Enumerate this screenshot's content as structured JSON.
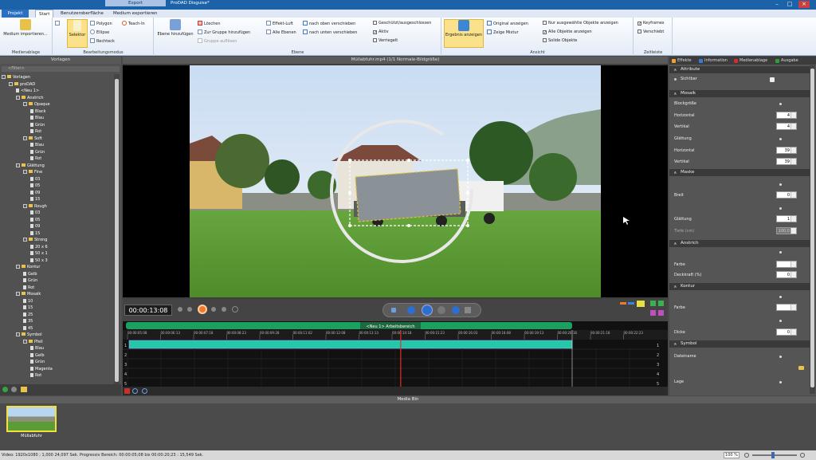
{
  "titlebar": {
    "contextual_tab": "Export",
    "title": "ProDAD Disguise*"
  },
  "tabs": [
    "Projekt",
    "Start",
    "Benutzeroberfläche",
    "Medium exportieren"
  ],
  "ribbon": {
    "groups": [
      {
        "label": "Medienablage"
      },
      {
        "label": "Bearbeitungsmodus"
      },
      {
        "label": "Ebene"
      },
      {
        "label": "Ansicht"
      },
      {
        "label": "Zeitleiste"
      }
    ],
    "import_label": "Medium importieren...",
    "selektor_label": "Selektor",
    "polygon_label": "Polygon",
    "ellipse_label": "Ellipse",
    "rechteck_label": "Rechteck",
    "teachin_label": "Teach-In",
    "ebene_add_label": "Ebene hinzufügen",
    "loeschen_label": "Löschen",
    "zur_gruppe_label": "Zur Gruppe hinzufügen",
    "aus_gruppe_label": "Gruppe auflösen",
    "effekt_luft_label": "Effekt-Luft",
    "alle_ebenen_label": "Alle Ebenen",
    "nach_oben_label": "nach oben verschieben",
    "nach_unten_label": "nach unten verschieben",
    "geschuetzt_label": "Geschützt/ausgeschlossen",
    "aktiv_label": "Aktiv",
    "verriegelt_label": "Verriegelt",
    "ergebnis_label": "Ergebnis anzeigen",
    "original_label": "Original anzeigen",
    "mixtur_label": "Zeige Mixtur",
    "nur_ausgew_label": "Nur ausgewählte Objekte anzeigen",
    "alle_objekte_label": "Alle Objekte anzeigen",
    "solide_label": "Solide Objekte",
    "keyframes_label": "Keyframes",
    "verschiebt_label": "Verschiebt"
  },
  "left_panel": {
    "title": "Vorlagen",
    "filter": "<Filter>",
    "tree": [
      {
        "label": "Vorlagen",
        "level": 0,
        "kind": "folder"
      },
      {
        "label": "proDAD",
        "level": 1,
        "kind": "folder"
      },
      {
        "label": "<Neu 1>",
        "level": 2,
        "kind": "item"
      },
      {
        "label": "Anstrich",
        "level": 2,
        "kind": "folder"
      },
      {
        "label": "Opaque",
        "level": 3,
        "kind": "folder"
      },
      {
        "label": "Black",
        "level": 4,
        "kind": "item"
      },
      {
        "label": "Blau",
        "level": 4,
        "kind": "item"
      },
      {
        "label": "Grün",
        "level": 4,
        "kind": "item"
      },
      {
        "label": "Rot",
        "level": 4,
        "kind": "item"
      },
      {
        "label": "Soft",
        "level": 3,
        "kind": "folder"
      },
      {
        "label": "Blau",
        "level": 4,
        "kind": "item"
      },
      {
        "label": "Grün",
        "level": 4,
        "kind": "item"
      },
      {
        "label": "Rot",
        "level": 4,
        "kind": "item"
      },
      {
        "label": "Glättung",
        "level": 2,
        "kind": "folder"
      },
      {
        "label": "Fine",
        "level": 3,
        "kind": "folder"
      },
      {
        "label": "03",
        "level": 4,
        "kind": "item"
      },
      {
        "label": "05",
        "level": 4,
        "kind": "item"
      },
      {
        "label": "09",
        "level": 4,
        "kind": "item"
      },
      {
        "label": "15",
        "level": 4,
        "kind": "item"
      },
      {
        "label": "Rough",
        "level": 3,
        "kind": "folder"
      },
      {
        "label": "03",
        "level": 4,
        "kind": "item"
      },
      {
        "label": "05",
        "level": 4,
        "kind": "item"
      },
      {
        "label": "09",
        "level": 4,
        "kind": "item"
      },
      {
        "label": "15",
        "level": 4,
        "kind": "item"
      },
      {
        "label": "Strong",
        "level": 3,
        "kind": "folder"
      },
      {
        "label": "20 x 6",
        "level": 4,
        "kind": "item"
      },
      {
        "label": "50 x 1",
        "level": 4,
        "kind": "item"
      },
      {
        "label": "50 x 3",
        "level": 4,
        "kind": "item"
      },
      {
        "label": "Kontur",
        "level": 2,
        "kind": "folder"
      },
      {
        "label": "Gelb",
        "level": 3,
        "kind": "item"
      },
      {
        "label": "Grün",
        "level": 3,
        "kind": "item"
      },
      {
        "label": "Rot",
        "level": 3,
        "kind": "item"
      },
      {
        "label": "Mosaik",
        "level": 2,
        "kind": "folder"
      },
      {
        "label": "10",
        "level": 3,
        "kind": "item"
      },
      {
        "label": "15",
        "level": 3,
        "kind": "item"
      },
      {
        "label": "25",
        "level": 3,
        "kind": "item"
      },
      {
        "label": "35",
        "level": 3,
        "kind": "item"
      },
      {
        "label": "45",
        "level": 3,
        "kind": "item"
      },
      {
        "label": "Symbol",
        "level": 2,
        "kind": "folder"
      },
      {
        "label": "Pfeil",
        "level": 3,
        "kind": "folder"
      },
      {
        "label": "Blau",
        "level": 4,
        "kind": "item"
      },
      {
        "label": "Gelb",
        "level": 4,
        "kind": "item"
      },
      {
        "label": "Grün",
        "level": 4,
        "kind": "item"
      },
      {
        "label": "Magenta",
        "level": 4,
        "kind": "item"
      },
      {
        "label": "Rot",
        "level": 4,
        "kind": "item"
      }
    ]
  },
  "center": {
    "video_title": "Müllabfuhr.mp4   (1/1  Normale-Bildgröße)",
    "timecode": "00:00:13:08",
    "timeline": {
      "clip_label": "<Neu 1>  Arbeitsbereich",
      "ruler_ticks": [
        "00:00:05:08",
        "00:00:06:13",
        "00:00:07:18",
        "00:00:08:23",
        "00:00:09:28",
        "00:00:11:02",
        "00:00:12:08",
        "00:00:13:13",
        "00:00:14:18",
        "00:00:15:23",
        "00:00:16:03",
        "00:00:18:08",
        "00:00:19:13",
        "00:00:20:18",
        "00:00:21:18",
        "00:00:22:23"
      ],
      "track_numbers_left": [
        "1",
        "2",
        "3",
        "4",
        "5"
      ],
      "track_numbers_right": [
        "1",
        "2",
        "3",
        "4",
        "5"
      ],
      "playhead_fraction": 0.51
    }
  },
  "right_panel": {
    "tabs": [
      "Effekte",
      "Information",
      "Medienablage",
      "Ausgabe"
    ],
    "tab_colors": [
      "#f0a030",
      "#3a7ad0",
      "#d03030",
      "#30a030"
    ],
    "sections": {
      "attribute": "Attribute",
      "sichtbar": "Sichtbar",
      "mosaik": "Mosaik",
      "blockgroesse": "Blockgröße",
      "horizontal": "Horizontal",
      "vertikal": "Vertikal",
      "horizontal_val": "4",
      "vertikal_val": "4",
      "glaettung": "Glättung",
      "g_horizontal": "Horizontal",
      "g_vertikal": "Vertikal",
      "g_horizontal_val": "39",
      "g_vertikal_val": "39",
      "maske": "Maske",
      "breit": "Breit",
      "breit_val": "0",
      "m_glaettung": "Glättung",
      "m_glaettung_val": "1",
      "tiefe": "Tiefe (cm)",
      "tiefe_val": "100,0",
      "anstrich": "Anstrich",
      "farbe": "Farbe",
      "deckkraft": "Deckkraft (%)",
      "deckkraft_val": "0",
      "kontur": "Kontur",
      "k_farbe": "Farbe",
      "dicke": "Dicke",
      "dicke_val": "0",
      "symbol": "Symbol",
      "dateiname": "Dateiname",
      "lage": "Lage"
    }
  },
  "media_bin": {
    "title": "Media Bin",
    "thumb_label": "Müllabfuhr"
  },
  "status": {
    "text": "Video: 1920x1080 ; 1,000   24,097 Sek.   Progressiv   Bereich: 00:00:05;08 bis 00:00:20;23 : 15,549 Sek.",
    "zoom": "100 %"
  }
}
